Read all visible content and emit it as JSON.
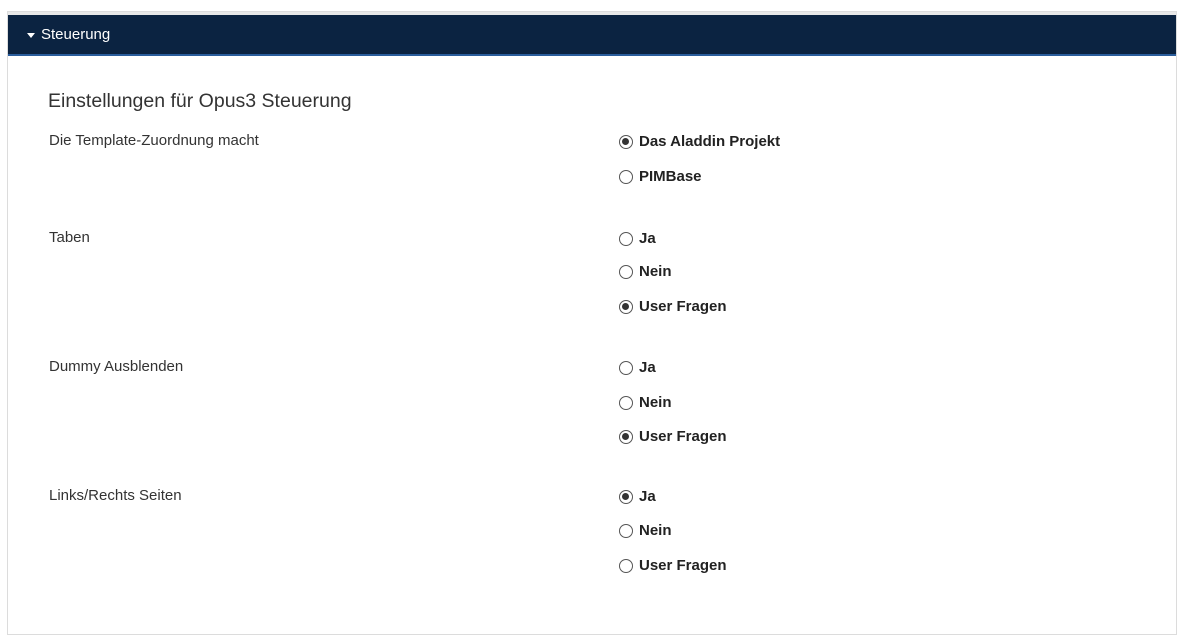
{
  "panel": {
    "header_title": "Steuerung",
    "section_title": "Einstellungen für Opus3 Steuerung"
  },
  "settings": [
    {
      "label": "Die Template-Zuordnung macht",
      "options": [
        {
          "label": "Das Aladdin Projekt",
          "checked": true
        },
        {
          "label": "PIMBase",
          "checked": false
        }
      ]
    },
    {
      "label": "Taben",
      "options": [
        {
          "label": "Ja",
          "checked": false
        },
        {
          "label": "Nein",
          "checked": false
        },
        {
          "label": "User Fragen",
          "checked": true
        }
      ]
    },
    {
      "label": "Dummy Ausblenden",
      "options": [
        {
          "label": "Ja",
          "checked": false
        },
        {
          "label": "Nein",
          "checked": false
        },
        {
          "label": "User Fragen",
          "checked": true
        }
      ]
    },
    {
      "label": "Links/Rechts Seiten",
      "options": [
        {
          "label": "Ja",
          "checked": true
        },
        {
          "label": "Nein",
          "checked": false
        },
        {
          "label": "User Fragen",
          "checked": false
        }
      ]
    }
  ],
  "colors": {
    "header_background": "#0b2341",
    "header_border": "#2a5d9c"
  }
}
